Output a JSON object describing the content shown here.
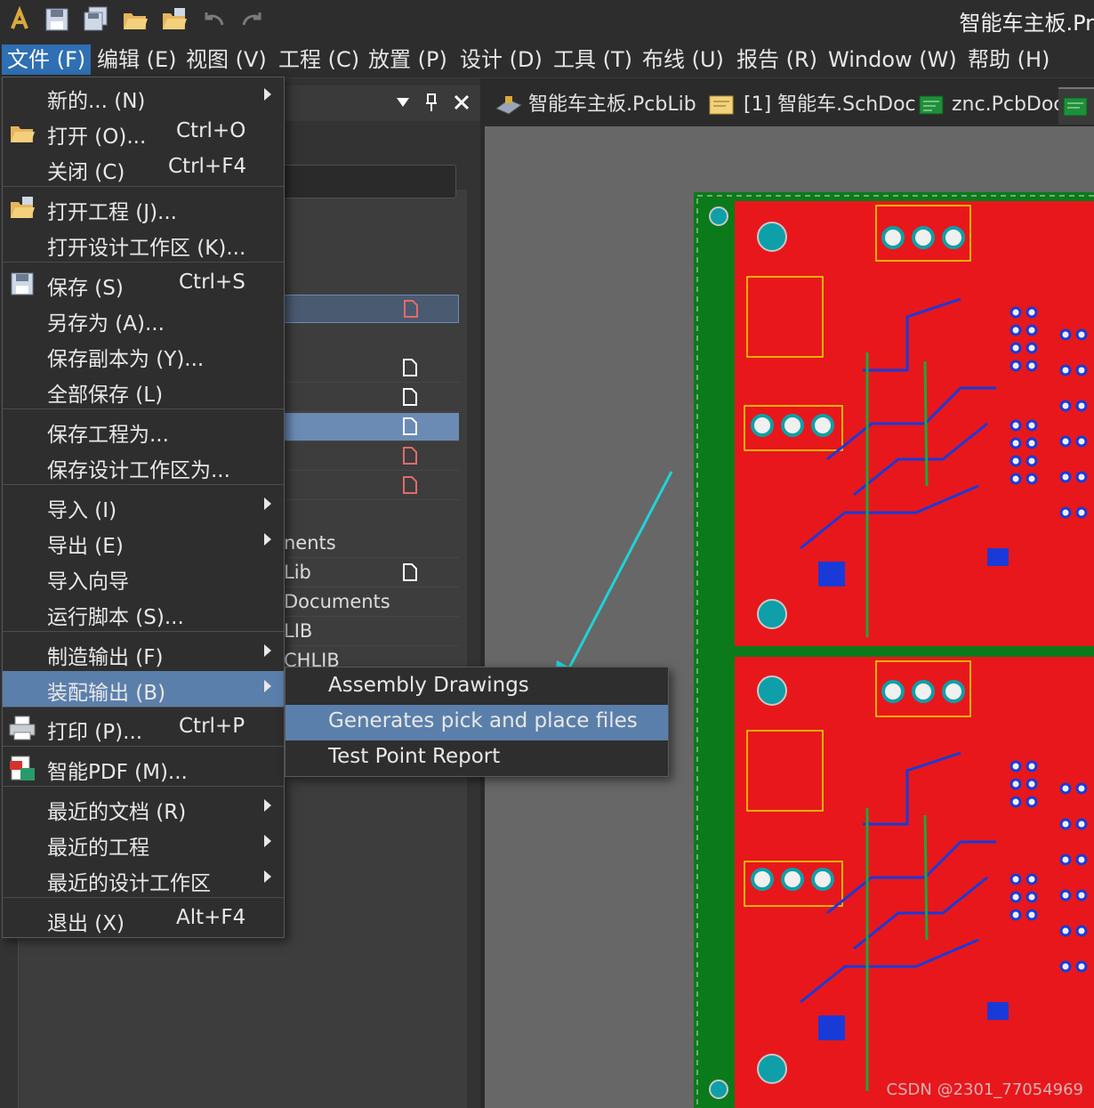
{
  "app": {
    "title": "智能车主板.Pr"
  },
  "menubar": {
    "items": [
      "文件 (F)",
      "编辑 (E)",
      "视图 (V)",
      "工程 (C)",
      "放置 (P)",
      "设计 (D)",
      "工具 (T)",
      "布线 (U)",
      "报告 (R)",
      "Window (W)",
      "帮助 (H)"
    ]
  },
  "tabs": [
    "智能车主板.PcbLib",
    "[1] 智能车.SchDoc",
    "znc.PcbDoc"
  ],
  "panel": {
    "rows": [
      "nents",
      "Lib",
      "Documents",
      "LIB",
      "CHLIB"
    ]
  },
  "file_menu": {
    "items": [
      {
        "label": "新的... (N)",
        "shortcut": ""
      },
      {
        "label": "打开 (O)...",
        "shortcut": "Ctrl+O"
      },
      {
        "label": "关闭 (C)",
        "shortcut": "Ctrl+F4"
      },
      {
        "label": "打开工程 (J)...",
        "shortcut": ""
      },
      {
        "label": "打开设计工作区 (K)...",
        "shortcut": ""
      },
      {
        "label": "保存 (S)",
        "shortcut": "Ctrl+S"
      },
      {
        "label": "另存为 (A)...",
        "shortcut": ""
      },
      {
        "label": "保存副本为 (Y)...",
        "shortcut": ""
      },
      {
        "label": "全部保存 (L)",
        "shortcut": ""
      },
      {
        "label": "保存工程为...",
        "shortcut": ""
      },
      {
        "label": "保存设计工作区为...",
        "shortcut": ""
      },
      {
        "label": "导入 (I)",
        "shortcut": ""
      },
      {
        "label": "导出 (E)",
        "shortcut": ""
      },
      {
        "label": "导入向导",
        "shortcut": ""
      },
      {
        "label": "运行脚本 (S)...",
        "shortcut": ""
      },
      {
        "label": "制造输出 (F)",
        "shortcut": ""
      },
      {
        "label": "装配输出 (B)",
        "shortcut": ""
      },
      {
        "label": "打印 (P)...",
        "shortcut": "Ctrl+P"
      },
      {
        "label": "智能PDF (M)...",
        "shortcut": ""
      },
      {
        "label": "最近的文档 (R)",
        "shortcut": ""
      },
      {
        "label": "最近的工程",
        "shortcut": ""
      },
      {
        "label": "最近的设计工作区",
        "shortcut": ""
      },
      {
        "label": "退出 (X)",
        "shortcut": "Alt+F4"
      }
    ]
  },
  "assembly_submenu": {
    "items": [
      "Assembly Drawings",
      "Generates pick and place files",
      "Test Point Report"
    ]
  },
  "watermark": "CSDN @2301_77054969",
  "colors": {
    "accent": "#5b7fab",
    "menu_bg": "#2e2e2e",
    "pcb_red": "#e8171b",
    "pcb_green": "#0b7a1a",
    "annotation_arrow": "#1fd3d8"
  }
}
